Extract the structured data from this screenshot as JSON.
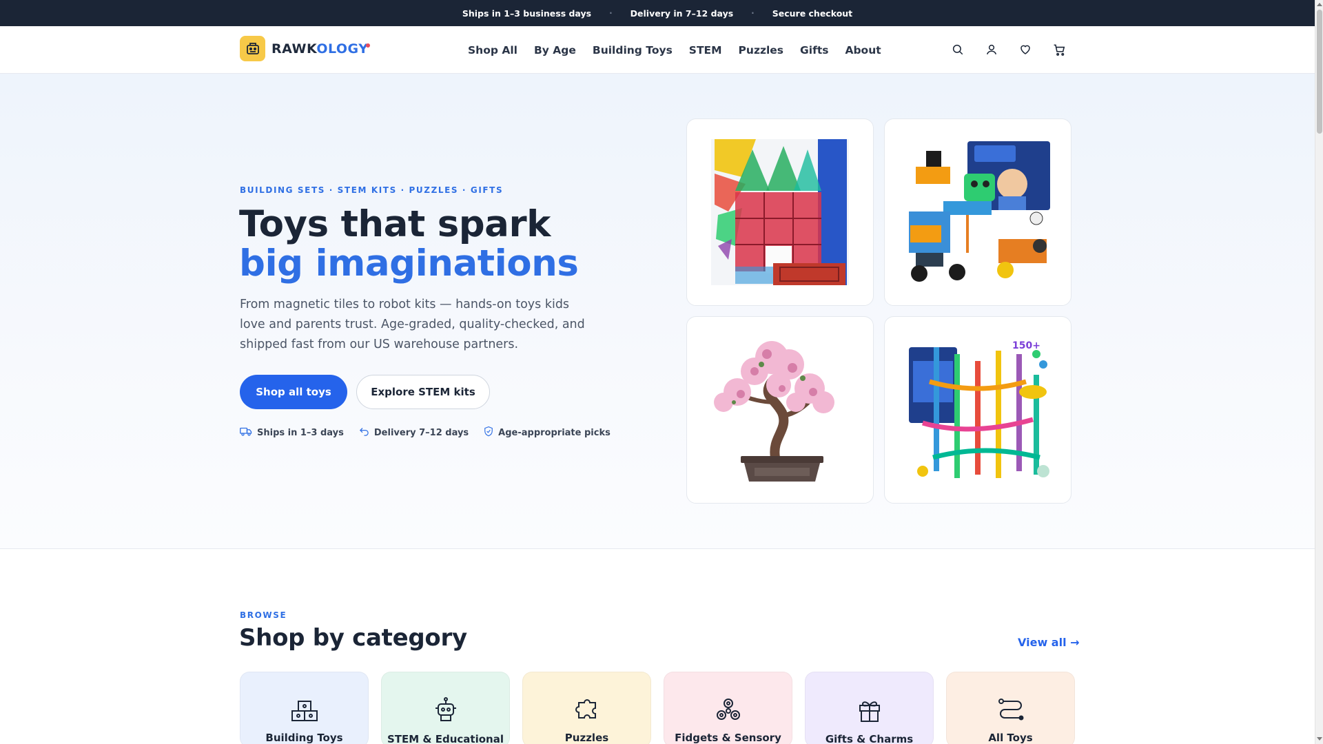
{
  "announcement": {
    "items": [
      "Ships in 1–3 business days",
      "Delivery in 7–12 days",
      "Secure checkout"
    ],
    "separator": "·"
  },
  "header": {
    "logo_part1": "RAWK",
    "logo_part2": "OLOGY",
    "nav": [
      "Shop All",
      "By Age",
      "Building Toys",
      "STEM",
      "Puzzles",
      "Gifts",
      "About"
    ],
    "icons": [
      "search-icon",
      "account-icon",
      "wishlist-icon",
      "cart-icon"
    ]
  },
  "hero": {
    "eyebrow": "BUILDING SETS · STEM KITS · PUZZLES · GIFTS",
    "title_main": "Toys that spark ",
    "title_accent": "big imaginations",
    "description": "From magnetic tiles to robot kits — hands-on toys kids love and parents trust. Age-graded, quality-checked, and shipped fast from our US warehouse partners.",
    "primary_button": "Shop all toys",
    "secondary_button": "Explore STEM kits",
    "perks": [
      {
        "icon": "truck-icon",
        "label": "Ships in 1–3 days"
      },
      {
        "icon": "return-icon",
        "label": "Delivery 7–12 days"
      },
      {
        "icon": "shield-icon",
        "label": "Age-appropriate picks"
      }
    ],
    "products": [
      "magnetic-tiles-image",
      "stem-robot-kit-image",
      "flower-bonsai-image",
      "marble-run-image"
    ]
  },
  "categories": {
    "eyebrow": "BROWSE",
    "title": "Shop by category",
    "view_all": "View all →",
    "items": [
      {
        "label": "Building Toys",
        "icon": "blocks-icon",
        "bg": "#e9f0fd"
      },
      {
        "label": "STEM & Educational",
        "icon": "robot-icon",
        "bg": "#e4f6ee"
      },
      {
        "label": "Puzzles",
        "icon": "puzzle-icon",
        "bg": "#fdf3d9"
      },
      {
        "label": "Fidgets & Sensory",
        "icon": "fidget-icon",
        "bg": "#fde8ec"
      },
      {
        "label": "Gifts & Charms",
        "icon": "gift-icon",
        "bg": "#efeafd"
      },
      {
        "label": "All Toys",
        "icon": "path-icon",
        "bg": "#fdeee3"
      }
    ]
  },
  "colors": {
    "accent": "#2563eb",
    "topbar": "#1b2536",
    "logo_mark": "#f7c948"
  }
}
